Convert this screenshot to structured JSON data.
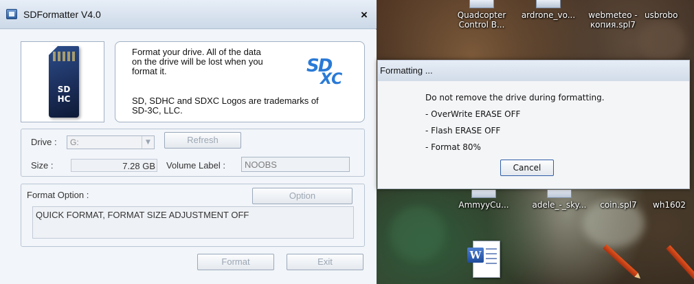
{
  "sd_formatter": {
    "title": "SDFormatter V4.0",
    "close_label": "×",
    "info_lines": [
      "Format your drive. All of the data",
      "on the drive will be lost when you",
      "format it.",
      "SD, SDHC and SDXC Logos are trademarks of",
      "SD-3C, LLC."
    ],
    "card_logo_top": "SD",
    "card_logo_bottom": "HC",
    "sdxc_logo_top": "SD",
    "sdxc_logo_bottom": "XC",
    "drive_label": "Drive :",
    "drive_value": "G:",
    "refresh_label": "Refresh",
    "size_label": "Size :",
    "size_value": "7.28 GB",
    "volume_label_label": "Volume Label :",
    "volume_label_value": "NOOBS",
    "format_option_label": "Format Option :",
    "option_button": "Option",
    "format_option_value": "QUICK FORMAT, FORMAT SIZE ADJUSTMENT OFF",
    "format_button": "Format",
    "exit_button": "Exit"
  },
  "formatting_dialog": {
    "title": "Formatting ...",
    "lines": [
      "Do not remove the drive during formatting.",
      "- OverWrite ERASE OFF",
      "- Flash ERASE OFF",
      "- Format  80%"
    ],
    "progress_percent": 80,
    "cancel_button": "Cancel"
  },
  "desktop": {
    "top_icons": [
      {
        "line1": "Quadcopter",
        "line2": "Control B..."
      },
      {
        "line1": "ardrone_vo...",
        "line2": ""
      },
      {
        "line1": "webmeteo -",
        "line2": "копия.spl7"
      },
      {
        "line1": "usbrobo",
        "line2": ""
      }
    ],
    "bottom_icons": [
      "AmmyyCu...",
      "adele_-_sky...",
      "coin.spl7",
      "wh1602"
    ],
    "word_icon": "W"
  }
}
